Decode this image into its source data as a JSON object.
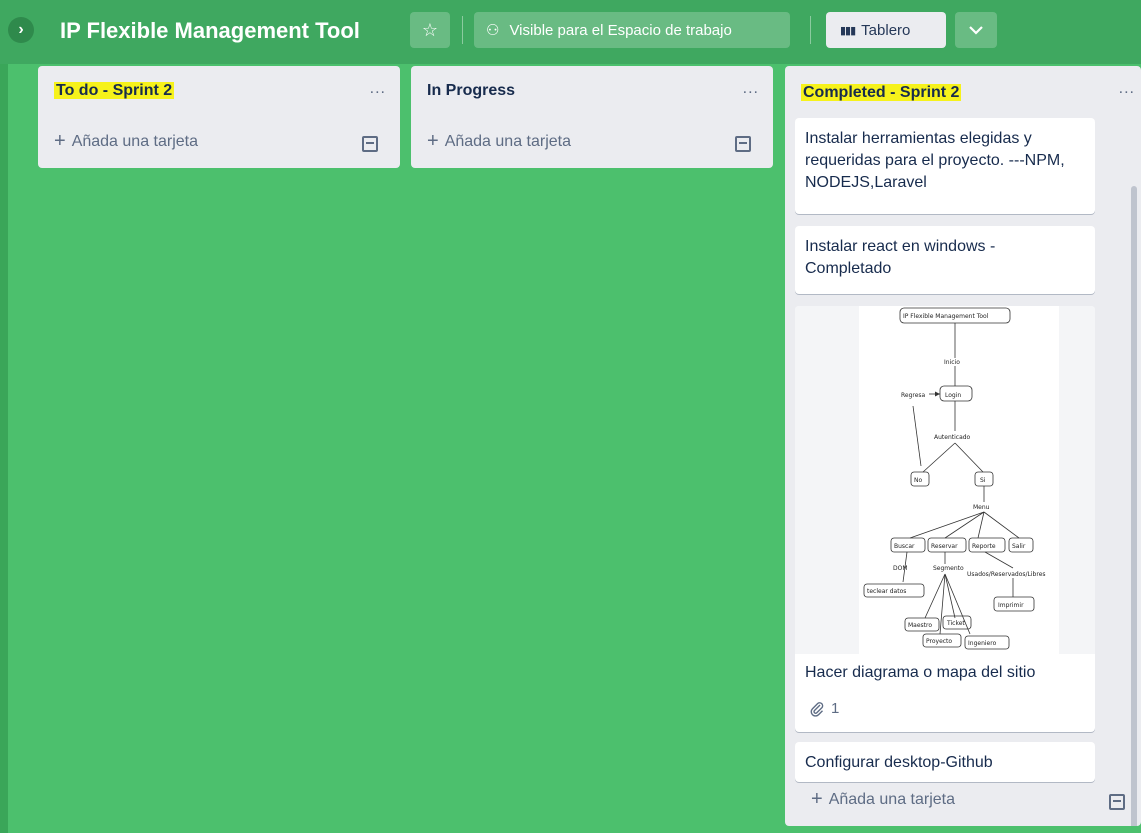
{
  "topbar": {
    "title": "IP Flexible Management Tool",
    "star_icon": "star-icon",
    "visibility_label": "Visible para el Espacio de trabajo",
    "board_view_label": "Tablero",
    "colors": {
      "bar": "#3fa860",
      "board_bg": "#4cc06d"
    }
  },
  "lists": [
    {
      "title": "To do - Sprint 2",
      "menu": "...",
      "add_card": "Añada una tarjeta"
    },
    {
      "title": "In Progress",
      "menu": "...",
      "add_card": "Añada una tarjeta"
    },
    {
      "title": "Completed - Sprint 2",
      "menu": "...",
      "add_card": "Añada una tarjeta",
      "cards": [
        {
          "text": "Instalar herramientas elegidas y requeridas para el proyecto. ---NPM, NODEJS,Laravel"
        },
        {
          "text": "Instalar react en windows - Completado"
        },
        {
          "text": "Hacer diagrama o mapa del sitio",
          "attachments": "1"
        },
        {
          "text": "Configurar desktop-Github"
        }
      ]
    }
  ],
  "diagram": {
    "root": "IP Flexible Management Tool",
    "inicio": "Inicio",
    "regresa": "Regresa",
    "login": "Login",
    "autenticado": "Autenticado",
    "no": "No",
    "si": "Si",
    "menu": "Menu",
    "buscar": "Buscar",
    "reservar": "Reservar",
    "reporte": "Reporte",
    "salir": "Salir",
    "dom": "DOM",
    "segmento": "Segmento",
    "usados": "Usados/Reservados/Libres",
    "teclear": "teclear datos",
    "imprimir": "Imprimir",
    "maestro": "Maestro",
    "ticket": "Ticket",
    "proyecto": "Proyecto",
    "ingeniero": "Ingeniero"
  }
}
